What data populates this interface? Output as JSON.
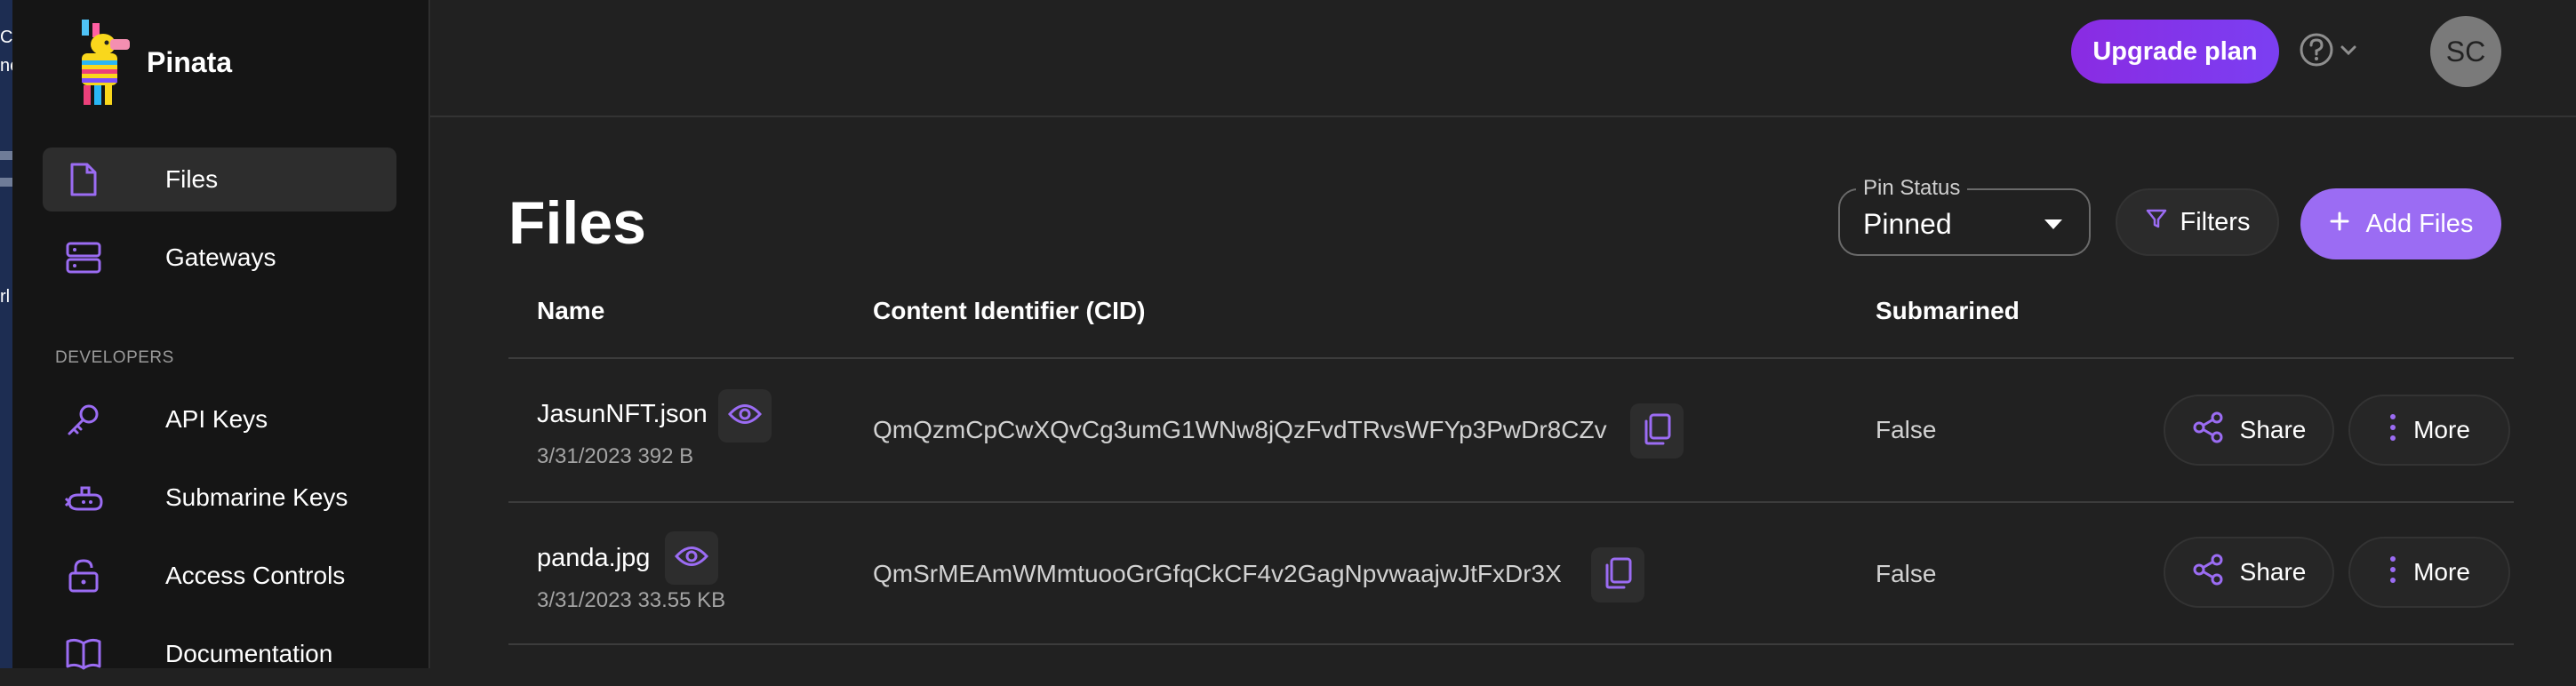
{
  "brand": {
    "name": "Pinata"
  },
  "sidebar": {
    "items": [
      {
        "label": "Files",
        "icon": "file-icon",
        "active": true
      },
      {
        "label": "Gateways",
        "icon": "server-icon"
      }
    ],
    "section_heading": "DEVELOPERS",
    "developer_items": [
      {
        "label": "API Keys",
        "icon": "key-icon"
      },
      {
        "label": "Submarine Keys",
        "icon": "submarine-icon"
      },
      {
        "label": "Access Controls",
        "icon": "lock-icon"
      },
      {
        "label": "Documentation",
        "icon": "book-icon"
      }
    ]
  },
  "left_strip": {
    "fragments": [
      "C",
      "ne",
      "rl"
    ]
  },
  "topbar": {
    "upgrade_label": "Upgrade plan",
    "avatar_initials": "SC",
    "help_icon": "question-icon"
  },
  "page": {
    "title": "Files",
    "pin_status": {
      "legend": "Pin Status",
      "value": "Pinned"
    },
    "filters_label": "Filters",
    "add_files_label": "Add Files"
  },
  "table": {
    "headers": [
      "Name",
      "Content Identifier (CID)",
      "Submarined"
    ],
    "rows": [
      {
        "name": "JasunNFT.json",
        "meta": "3/31/2023 392 B",
        "cid": "QmQzmCpCwXQvCg3umG1WNw8jQzFvdTRvsWFYp3PwDr8CZv",
        "submarined": "False",
        "share": "Share",
        "more": "More"
      },
      {
        "name": "panda.jpg",
        "meta": "3/31/2023 33.55 KB",
        "cid": "QmSrMEAmWMmtuooGrGfqCkCF4v2GagNpvwaajwJtFxDr3X",
        "submarined": "False",
        "share": "Share",
        "more": "More"
      }
    ]
  },
  "colors": {
    "accent": "#9b6cf3",
    "background": "#212121",
    "sidebar": "#151515",
    "upgrade": "#8a2be2"
  }
}
